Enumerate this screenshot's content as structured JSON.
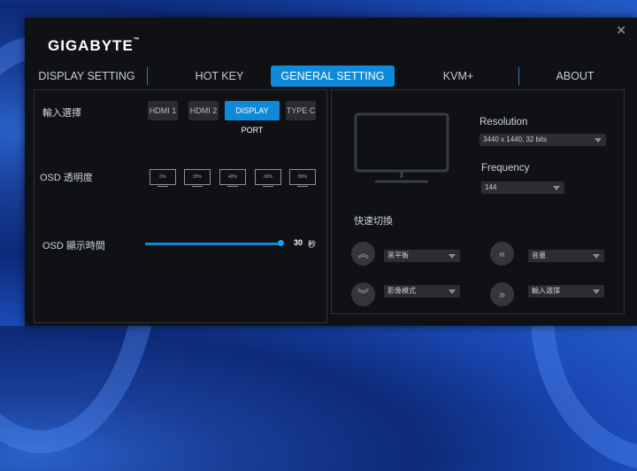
{
  "app": {
    "brand": "GIGABYTE",
    "trademark": "™",
    "close_icon": "close-icon"
  },
  "tabs": [
    {
      "label": "DISPLAY SETTING"
    },
    {
      "label": "HOT KEY"
    },
    {
      "label": "GENERAL SETTING",
      "active": true
    },
    {
      "label": "KVM+"
    },
    {
      "label": "ABOUT"
    }
  ],
  "left": {
    "input_label": "輸入選擇",
    "inputs": [
      "HDMI 1",
      "HDMI 2",
      "DISPLAY PORT",
      "TYPE C"
    ],
    "active_input": "DISPLAY PORT",
    "osd_transparency_label": "OSD 透明度",
    "transparency_levels": [
      "0%",
      "20%",
      "40%",
      "60%",
      "80%"
    ],
    "osd_time_label": "OSD 顯示時間",
    "osd_time_value": "30",
    "osd_time_unit": "秒",
    "osd_time_fraction": 1.0
  },
  "right": {
    "resolution_label": "Resolution",
    "resolution_value": "3440 x 1440, 32 bits",
    "frequency_label": "Frequency",
    "frequency_value": "144",
    "quick_switch_label": "快速切換",
    "quick_items": [
      {
        "icon": "chevron-double-up-icon",
        "glyph": "︽",
        "value": "黑平衡"
      },
      {
        "icon": "chevron-double-left-icon",
        "glyph": "«",
        "value": "音量"
      },
      {
        "icon": "chevron-double-down-icon",
        "glyph": "︾",
        "value": "影像模式"
      },
      {
        "icon": "chevron-double-right-icon",
        "glyph": "»",
        "value": "輸入選擇"
      }
    ]
  },
  "colors": {
    "accent": "#0e8ad8",
    "window_bg": "#0f1114"
  }
}
